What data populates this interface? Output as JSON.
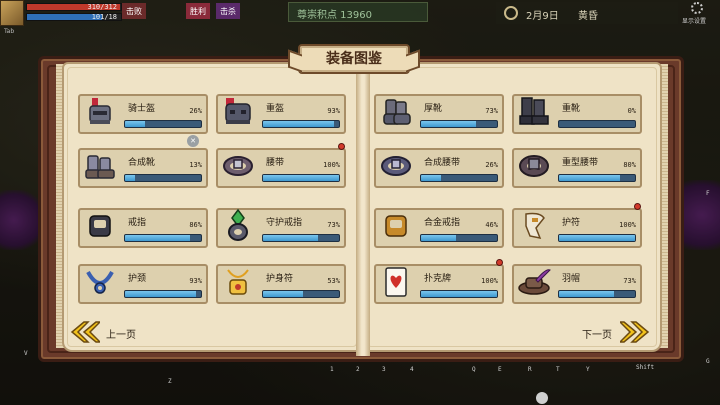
{
  "hud": {
    "tab_hint": "Tab",
    "hp": "310/312",
    "mp": "101/18",
    "hp_color": "#c0392b",
    "mp_color": "#2f6fb7",
    "badge1": "击败",
    "badge2": "胜利",
    "badge3": "击杀",
    "score_text": "尊崇积点 13960",
    "date": "2月9日",
    "time": "黄昏",
    "settings_label": "显示设置"
  },
  "keys": {
    "v": "V",
    "c": "C",
    "z": "Z",
    "g": "G",
    "f": "F",
    "n1": "1",
    "n2": "2",
    "n3": "3",
    "n4": "4",
    "q": "Q",
    "e": "E",
    "r": "R",
    "t": "T",
    "y": "Y",
    "shift": "Shift"
  },
  "book": {
    "title": "装备图鉴",
    "prev_label": "上一页",
    "next_label": "下一页",
    "left_items": [
      {
        "name": "骑士盔",
        "pct": "26%",
        "value": 26,
        "icon": "knight-helmet-icon",
        "dot": false
      },
      {
        "name": "重盔",
        "pct": "93%",
        "value": 93,
        "icon": "heavy-helmet-icon",
        "dot": false
      },
      {
        "name": "合成靴",
        "pct": "13%",
        "value": 13,
        "icon": "composite-boots-icon",
        "dot": false
      },
      {
        "name": "腰带",
        "pct": "100%",
        "value": 100,
        "icon": "belt-icon",
        "dot": true
      },
      {
        "name": "戒指",
        "pct": "86%",
        "value": 86,
        "icon": "ring-icon",
        "dot": false
      },
      {
        "name": "守护戒指",
        "pct": "73%",
        "value": 73,
        "icon": "guardian-ring-icon",
        "dot": false
      },
      {
        "name": "护颈",
        "pct": "93%",
        "value": 93,
        "icon": "neck-guard-icon",
        "dot": false
      },
      {
        "name": "护身符",
        "pct": "53%",
        "value": 53,
        "icon": "amulet-icon",
        "dot": false
      }
    ],
    "right_items": [
      {
        "name": "厚靴",
        "pct": "73%",
        "value": 73,
        "icon": "thick-boots-icon",
        "dot": false
      },
      {
        "name": "重靴",
        "pct": "0%",
        "value": 0,
        "icon": "heavy-boots-icon",
        "dot": false
      },
      {
        "name": "合成腰带",
        "pct": "26%",
        "value": 26,
        "icon": "composite-belt-icon",
        "dot": false
      },
      {
        "name": "重型腰带",
        "pct": "80%",
        "value": 80,
        "icon": "heavy-belt-icon",
        "dot": false
      },
      {
        "name": "合金戒指",
        "pct": "46%",
        "value": 46,
        "icon": "alloy-ring-icon",
        "dot": false
      },
      {
        "name": "护符",
        "pct": "100%",
        "value": 100,
        "icon": "talisman-icon",
        "dot": true
      },
      {
        "name": "扑克牌",
        "pct": "100%",
        "value": 100,
        "icon": "poker-card-icon",
        "dot": true
      },
      {
        "name": "羽帽",
        "pct": "73%",
        "value": 73,
        "icon": "feather-hat-icon",
        "dot": false
      }
    ]
  },
  "colors": {
    "bar_fill": "#5db4e6",
    "bar_track": "#3a5a78",
    "page": "#efe3c6",
    "card": "#ddd0ae",
    "arrow": "#f2c21b"
  }
}
